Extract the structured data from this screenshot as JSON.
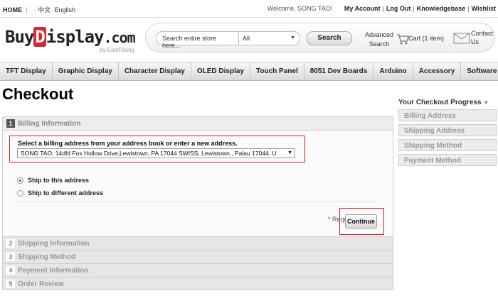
{
  "topbar": {
    "home": "HOME",
    "lang_chinese": "中文",
    "lang_english": "English",
    "welcome": "Welcome, SONG TAO!",
    "links": [
      "My Account",
      "Log Out",
      "Knowledgebase",
      "Wishlist"
    ]
  },
  "logo": {
    "part1": "Buy",
    "part2": "D",
    "part3": "isplay",
    "part4": ".com",
    "byline": "by EastRising"
  },
  "search": {
    "placeholder": "Search entire store here...",
    "category": "All",
    "button": "Search",
    "advanced_line1": "Advanced",
    "advanced_line2": "Search"
  },
  "cart": {
    "label": "Cart (1 item)"
  },
  "contact": {
    "label": "Contact Us"
  },
  "nav": {
    "items": [
      "TFT Display",
      "Graphic Display",
      "Character Display",
      "OLED Display",
      "Touch Panel",
      "8051 Dev Boards",
      "Arduino",
      "Accessory",
      "Software"
    ]
  },
  "page": {
    "title": "Checkout"
  },
  "checkout": {
    "steps": [
      {
        "num": "1",
        "label": "Billing Information"
      },
      {
        "num": "2",
        "label": "Shipping Information"
      },
      {
        "num": "3",
        "label": "Shipping Method"
      },
      {
        "num": "4",
        "label": "Payment Information"
      },
      {
        "num": "5",
        "label": "Order Review"
      }
    ],
    "billing_prompt": "Select a billing address from your address book or enter a new address.",
    "billing_address": "SONG TAO, 14dfd Fox Hollow Drive,Lewistown, PA 17044 SWISS, Lewistown,, Palau 17044, U",
    "ship_to_this": "Ship to this address",
    "ship_to_different": "Ship to different address",
    "required": "Required Fields",
    "required_star": "*",
    "continue": "Continue"
  },
  "sidebar": {
    "title": "Your Checkout Progress",
    "items": [
      "Billing Address",
      "Shipping Address",
      "Shipping Method",
      "Payment Method"
    ]
  },
  "colors": {
    "highlight_red": "#e02020",
    "logo_red": "#d7262e",
    "nav_bg": "#e6e6e6"
  }
}
